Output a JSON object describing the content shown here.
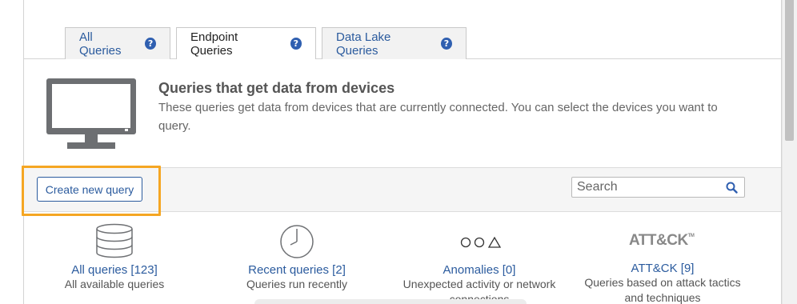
{
  "tabs": [
    {
      "label": "All Queries",
      "help_icon": "help-circle-icon"
    },
    {
      "label": "Endpoint Queries",
      "help_icon": "help-circle-icon",
      "active": true
    },
    {
      "label": "Data Lake Queries",
      "help_icon": "help-circle-icon"
    }
  ],
  "header": {
    "icon": "monitor-icon",
    "title": "Queries that get data from devices",
    "description": "These queries get data from devices that are currently connected. You can select the devices you want to query."
  },
  "toolbar": {
    "create_label": "Create new query",
    "search_placeholder": "Search",
    "search_icon": "search-icon"
  },
  "categories": [
    {
      "icon": "database-icon",
      "title": "All queries [123]",
      "description": "All available queries"
    },
    {
      "icon": "clock-icon",
      "title": "Recent queries [2]",
      "description": "Queries run recently"
    },
    {
      "icon": "shapes-icon",
      "title": "Anomalies [0]",
      "description": "Unexpected activity or network connections"
    },
    {
      "icon": "attck-logo",
      "logo_text": "ATT&CK",
      "title": "ATT&CK [9]",
      "description": "Queries based on attack tactics and techniques"
    }
  ],
  "colors": {
    "link": "#2b5b9e",
    "highlight": "#f5a623",
    "help_badge": "#2f5fb0"
  }
}
